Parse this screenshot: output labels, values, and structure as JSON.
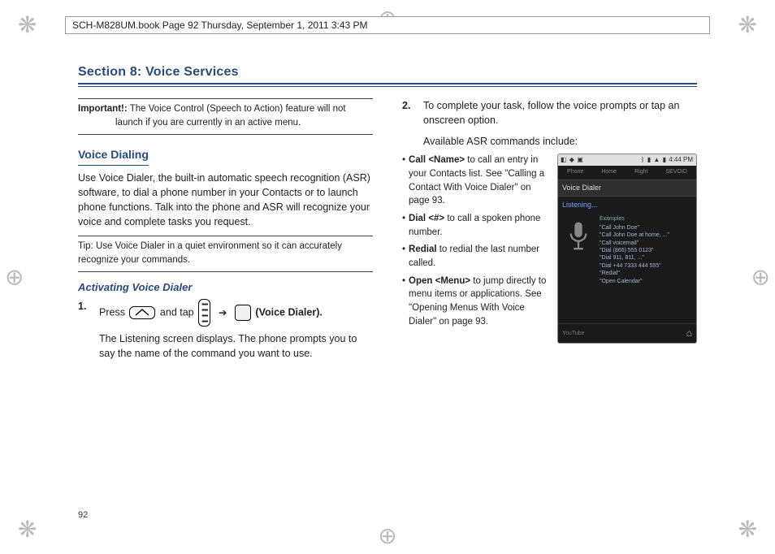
{
  "header": "SCH-M828UM.book  Page 92  Thursday, September 1, 2011  3:43 PM",
  "section_title": "Section 8: Voice Services",
  "page_number": "92",
  "col1": {
    "important": {
      "lead": "Important!:",
      "body": "The Voice Control (Speech to Action) feature will not launch if you are currently in an active menu."
    },
    "voice_dialing_heading": "Voice Dialing",
    "voice_dialing_para": "Use Voice Dialer, the built-in automatic speech recognition (ASR) software, to dial a phone number in your Contacts or to launch phone functions. Talk into the phone and ASR will recognize your voice and complete tasks you request.",
    "tip": {
      "lead": "Tip:",
      "body": "Use Voice Dialer in a quiet environment so it can accurately recognize your commands."
    },
    "activating_heading": "Activating Voice Dialer",
    "step1": {
      "num": "1.",
      "press": "Press",
      "and_tap": "and tap",
      "arrow": "➔",
      "voice_dialer": "(Voice Dialer).",
      "tail": "The Listening screen displays. The phone prompts you to say the name of the command you want to use."
    }
  },
  "col2": {
    "step2": {
      "num": "2.",
      "body": "To complete your task, follow the voice prompts or tap an onscreen option.",
      "avail": "Available ASR commands include:"
    },
    "commands": [
      {
        "lead": "Call <Name>",
        "body": " to call an entry in your Contacts list. See \"Calling a Contact With Voice Dialer\" on page 93."
      },
      {
        "lead": "Dial <#>",
        "body": " to call a spoken phone number."
      },
      {
        "lead": "Redial",
        "body": " to redial the last number called."
      },
      {
        "lead": "Open <Menu>",
        "body": " to jump directly to menu items or applications. See \"Opening Menus With Voice Dialer\" on page 93."
      }
    ],
    "phone": {
      "time": "4:44 PM",
      "deck": [
        "Phone",
        "Home",
        "Right",
        "SEVOID"
      ],
      "vd_title": "Voice Dialer",
      "listening": "Listening...",
      "examples_hd": "Examples",
      "examples": [
        "\"Call John Doe\"",
        "\"Call John Doe at home, ...\"",
        "\"Call voicemail\"",
        "\"Dial (866) 555 0123\"",
        "\"Dial 911, 811, ...\"",
        "\"Dial +44 7333 444 555\"",
        "\"Redial\"",
        "\"Open Calendar\""
      ],
      "bottom_left": "YouTube"
    }
  }
}
